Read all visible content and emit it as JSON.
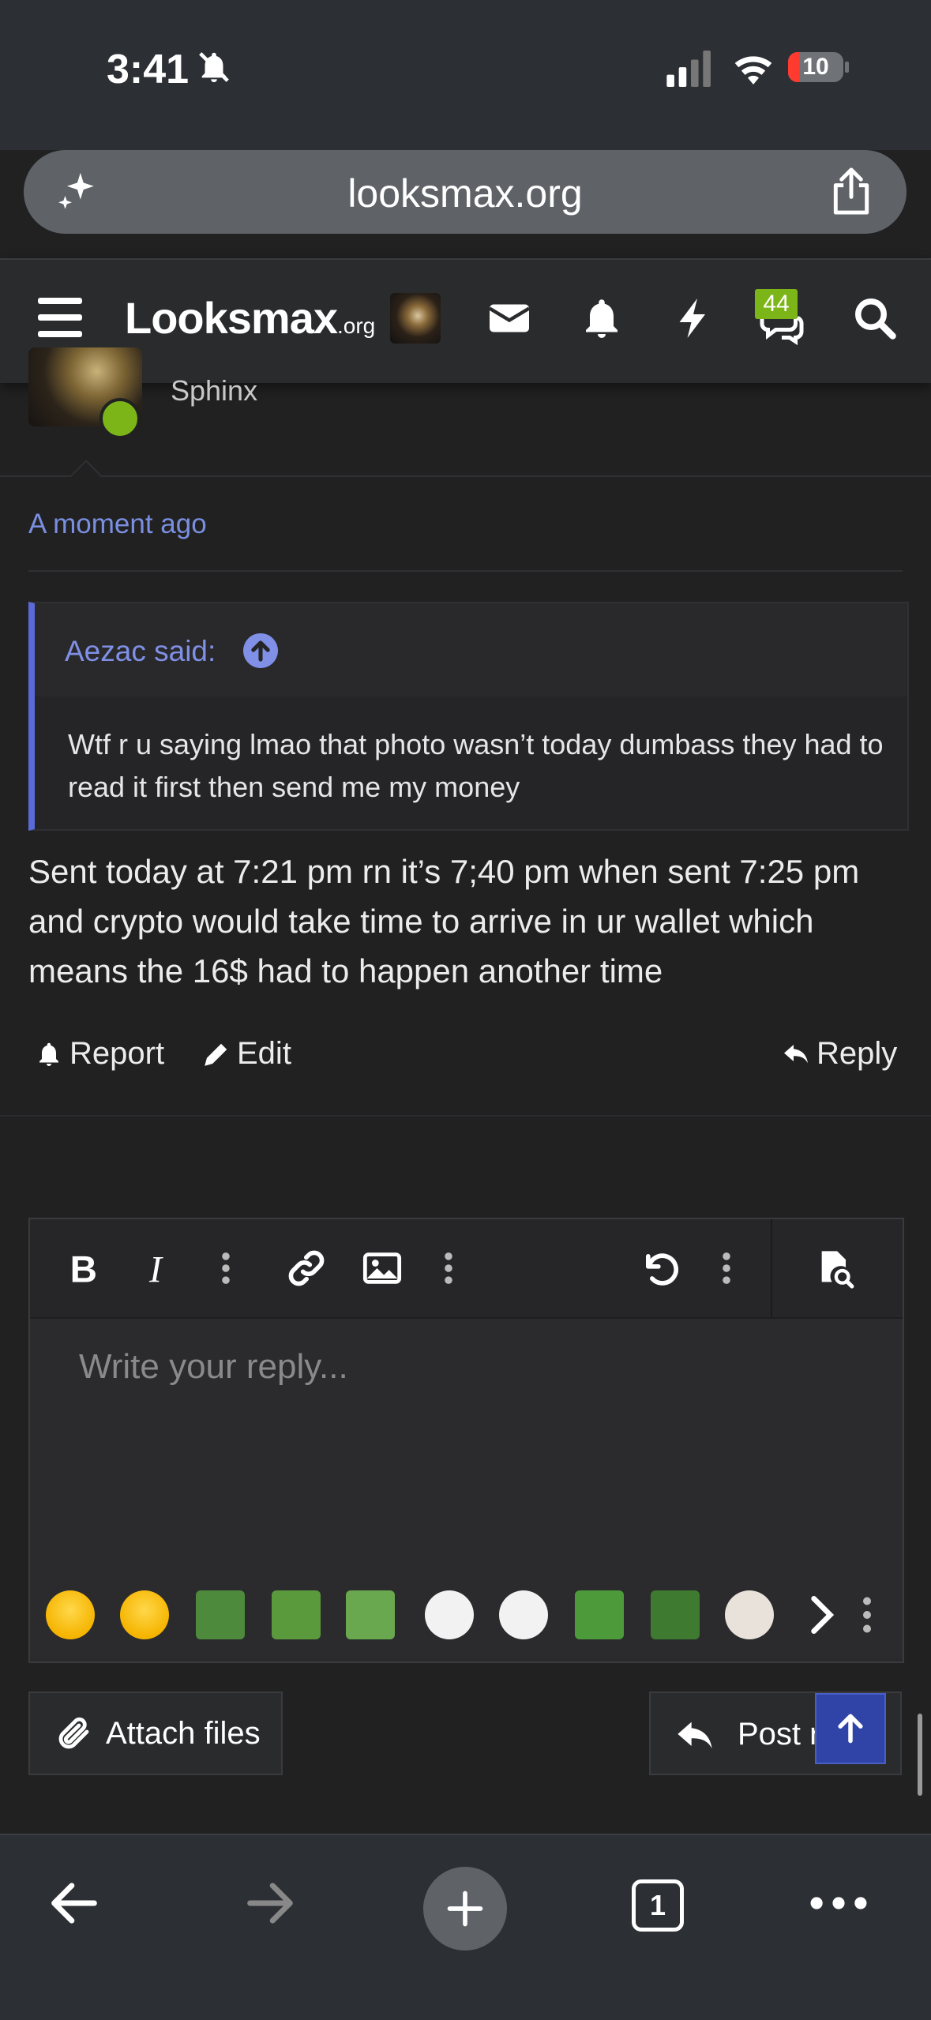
{
  "status_bar": {
    "time": "3:41",
    "battery": "10"
  },
  "browser": {
    "url": "looksmax.org"
  },
  "site": {
    "logo_main": "Lo​o​ksmax",
    "logo_suffix": ".org",
    "chat_badge": "44"
  },
  "post": {
    "username_sub": "Sphinx",
    "time": "A moment ago",
    "quote": {
      "author": "Aezac said:",
      "text": "Wtf r u saying lmao that photo wasn’t today dumbass they had to read it first then send me my money"
    },
    "body": "Sent today at 7:21 pm rn it’s 7;40 pm when sent 7:25 pm and crypto would take time to arrive in ur wallet which means the 16$ had to happen another time",
    "actions": {
      "report": "Report",
      "edit": "Edit",
      "reply": "Reply"
    }
  },
  "editor": {
    "placeholder": "Write your reply...",
    "attach_label": "Attach files",
    "post_reply_label": "Post reply"
  },
  "bottom_bar": {
    "tab_count": "1"
  }
}
